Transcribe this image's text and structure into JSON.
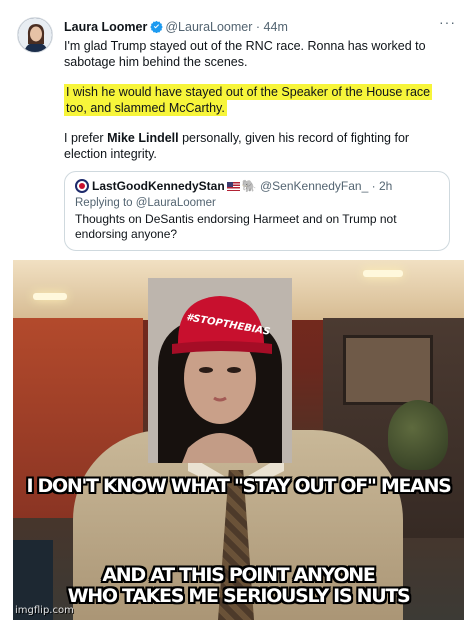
{
  "tweet": {
    "author_name": "Laura Loomer",
    "author_handle": "@LauraLoomer",
    "time_separator": "·",
    "time": "44m",
    "more_menu": "···",
    "paragraph_1": "I'm glad Trump stayed out of the RNC race. Ronna has worked to sabotage him behind the scenes.",
    "paragraph_2_highlighted": "I wish he would have stayed out of the Speaker of the House race too, and slammed McCarthy.",
    "paragraph_3_prefix": "I prefer ",
    "paragraph_3_bold": "Mike Lindell",
    "paragraph_3_suffix": " personally, given his record of fighting for election integrity.",
    "highlight_color": "#f7f53a"
  },
  "quoted_tweet": {
    "author_name": "LastGoodKennedyStan",
    "author_handle": "@SenKennedyFan_",
    "time_separator": "·",
    "time": "2h",
    "replying_to": "Replying to @LauraLoomer",
    "text": "Thoughts on DeSantis endorsing Harmeet and on Trump not endorsing anyone?"
  },
  "meme": {
    "hat_text": "#STOPTHEBIAS",
    "caption_top": "I DON'T KNOW WHAT \"STAY OUT OF\" MEANS",
    "caption_bottom_line_1": "AND AT THIS POINT ANYONE",
    "caption_bottom_line_2": "WHO TAKES ME SERIOUSLY IS NUTS",
    "watermark": "imgflip.com"
  },
  "icons": {
    "verified": "verified-badge-icon",
    "flag": "us-flag-icon",
    "elephant": "elephant-icon"
  },
  "colors": {
    "verified_blue": "#1d9bf0",
    "text_primary": "#0f1419",
    "text_secondary": "#536471",
    "hat_red": "#c8102e"
  }
}
